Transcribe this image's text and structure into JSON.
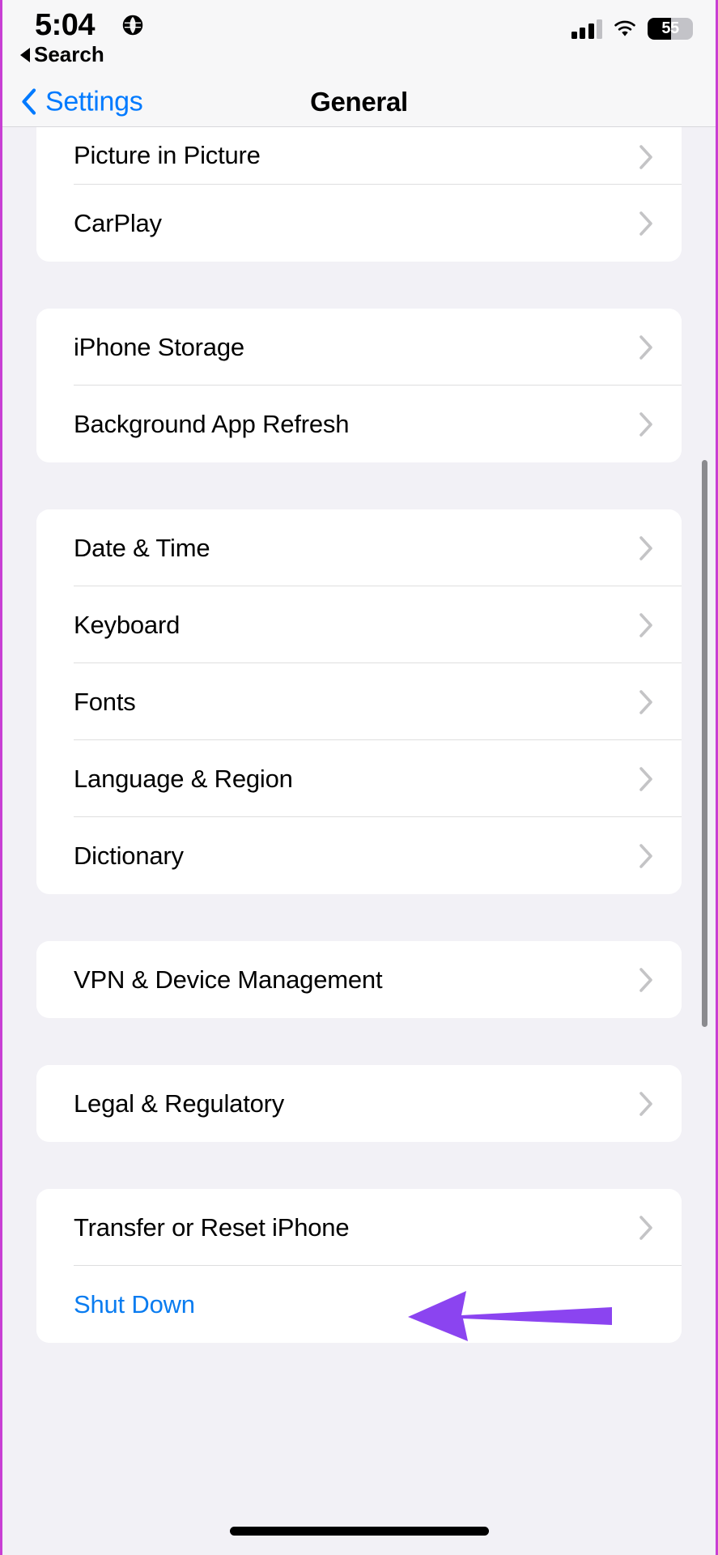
{
  "status_bar": {
    "time": "5:04",
    "location_icon": "globe-icon",
    "cellular_icon": "cellular-signal-icon",
    "cellular_bars_filled": 3,
    "cellular_bars_total": 4,
    "wifi_icon": "wifi-icon",
    "battery_percent": "55",
    "battery_icon": "battery-icon"
  },
  "back_to_app": {
    "label": "Search",
    "icon": "back-triangle-icon"
  },
  "nav": {
    "back_label": "Settings",
    "back_icon": "chevron-left-icon",
    "title": "General"
  },
  "colors": {
    "accent_blue": "#007AFF",
    "link_blue": "#0a7cf0",
    "background": "#F2F1F6",
    "card": "#FFFFFF",
    "separator": "#DEDEDF",
    "chevron_gray": "#C4C4C6",
    "annotation_purple": "#8B44F0",
    "frame_magenta": "#C83FD4"
  },
  "groups": [
    {
      "id": "group-display",
      "rows": [
        {
          "label": "Picture in Picture",
          "accessory": "chevron-right-icon",
          "style": "default"
        },
        {
          "label": "CarPlay",
          "accessory": "chevron-right-icon",
          "style": "default"
        }
      ]
    },
    {
      "id": "group-storage",
      "rows": [
        {
          "label": "iPhone Storage",
          "accessory": "chevron-right-icon",
          "style": "default"
        },
        {
          "label": "Background App Refresh",
          "accessory": "chevron-right-icon",
          "style": "default"
        }
      ]
    },
    {
      "id": "group-locale",
      "rows": [
        {
          "label": "Date & Time",
          "accessory": "chevron-right-icon",
          "style": "default"
        },
        {
          "label": "Keyboard",
          "accessory": "chevron-right-icon",
          "style": "default"
        },
        {
          "label": "Fonts",
          "accessory": "chevron-right-icon",
          "style": "default"
        },
        {
          "label": "Language & Region",
          "accessory": "chevron-right-icon",
          "style": "default"
        },
        {
          "label": "Dictionary",
          "accessory": "chevron-right-icon",
          "style": "default"
        }
      ]
    },
    {
      "id": "group-vpn",
      "rows": [
        {
          "label": "VPN & Device Management",
          "accessory": "chevron-right-icon",
          "style": "default"
        }
      ]
    },
    {
      "id": "group-legal",
      "rows": [
        {
          "label": "Legal & Regulatory",
          "accessory": "chevron-right-icon",
          "style": "default"
        }
      ]
    },
    {
      "id": "group-reset",
      "rows": [
        {
          "label": "Transfer or Reset iPhone",
          "accessory": "chevron-right-icon",
          "style": "default"
        },
        {
          "label": "Shut Down",
          "accessory": "none",
          "style": "blue"
        }
      ]
    }
  ],
  "annotation": {
    "type": "arrow",
    "points_to": "Transfer or Reset iPhone",
    "color": "#8B44F0"
  }
}
